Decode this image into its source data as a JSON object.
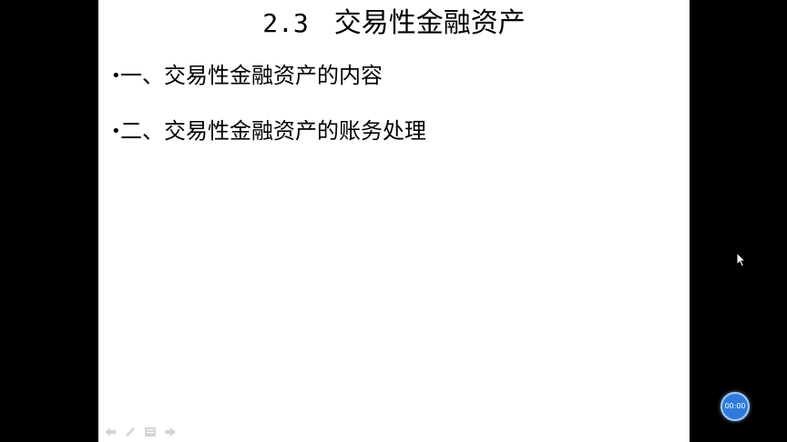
{
  "slide": {
    "title_number": "2.3",
    "title_text": "交易性金融资产",
    "bullets": [
      {
        "marker": "•",
        "text": "一、交易性金融资产的内容"
      },
      {
        "marker": "•",
        "text": "二、交易性金融资产的账务处理"
      }
    ]
  },
  "toolbar": {
    "icons": [
      "arrow-left-icon",
      "pen-icon",
      "menu-icon",
      "arrow-right-icon"
    ]
  },
  "recording_timer": {
    "time": "00:00",
    "color": "#2e7bdc"
  },
  "colors": {
    "background": "#000000",
    "slide": "#ffffff",
    "text": "#000000"
  }
}
